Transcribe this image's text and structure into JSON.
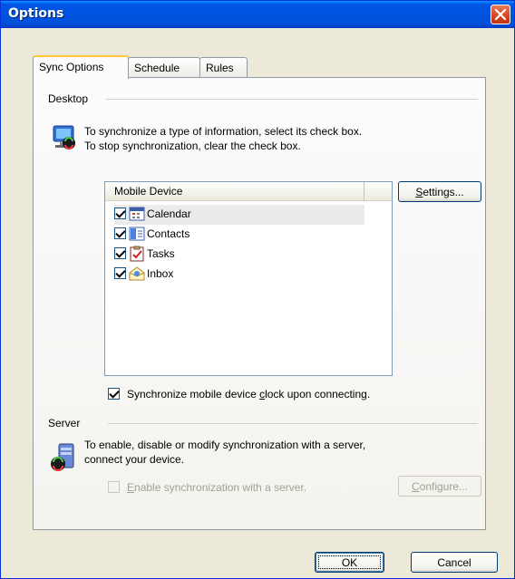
{
  "window": {
    "title": "Options"
  },
  "tabs": [
    {
      "label": "Sync Options"
    },
    {
      "label": "Schedule"
    },
    {
      "label": "Rules"
    }
  ],
  "desktop": {
    "group_label": "Desktop",
    "desc_line1": "To synchronize a type of information, select its check box.",
    "desc_line2": "To stop synchronization, clear the check box.",
    "list_header": "Mobile Device",
    "items": [
      {
        "label": "Calendar",
        "checked": true,
        "icon": "calendar-icon"
      },
      {
        "label": "Contacts",
        "checked": true,
        "icon": "contacts-icon"
      },
      {
        "label": "Tasks",
        "checked": true,
        "icon": "tasks-icon"
      },
      {
        "label": "Inbox",
        "checked": true,
        "icon": "inbox-icon"
      }
    ],
    "settings_button": {
      "pre": "",
      "u": "S",
      "post": "ettings..."
    },
    "clock_checkbox": {
      "checked": true,
      "pre": "Synchronize mobile device ",
      "u": "c",
      "post": "lock upon connecting."
    }
  },
  "server": {
    "group_label": "Server",
    "desc_line1": "To enable, disable or modify synchronization with a server,",
    "desc_line2": "connect your device.",
    "enable_checkbox": {
      "checked": false,
      "enabled": false,
      "pre": "",
      "u": "E",
      "post": "nable synchronization with a server."
    },
    "configure_button": {
      "pre": "",
      "u": "C",
      "post": "onfigure..."
    }
  },
  "footer": {
    "ok_label": "OK",
    "cancel_label": "Cancel"
  }
}
